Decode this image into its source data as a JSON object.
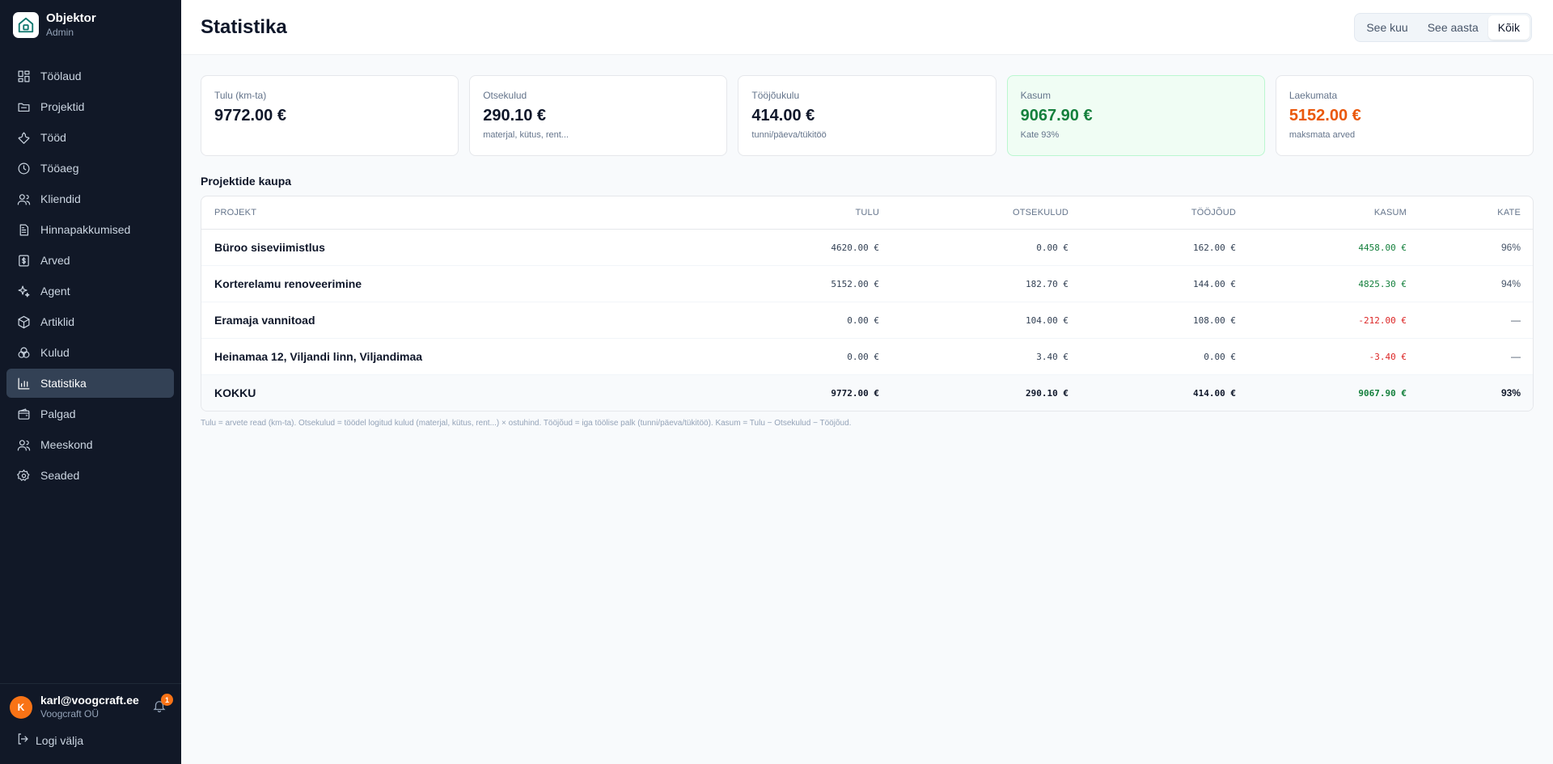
{
  "app": {
    "name": "Objektor",
    "role": "Admin"
  },
  "nav": {
    "items": [
      {
        "label": "Töölaud",
        "icon": "dashboard-icon"
      },
      {
        "label": "Projektid",
        "icon": "folder-icon"
      },
      {
        "label": "Tööd",
        "icon": "wrench-icon"
      },
      {
        "label": "Tööaeg",
        "icon": "clock-icon"
      },
      {
        "label": "Kliendid",
        "icon": "users-icon"
      },
      {
        "label": "Hinnapakkumised",
        "icon": "document-icon"
      },
      {
        "label": "Arved",
        "icon": "invoice-icon"
      },
      {
        "label": "Agent",
        "icon": "sparkles-icon"
      },
      {
        "label": "Artiklid",
        "icon": "box-icon"
      },
      {
        "label": "Kulud",
        "icon": "coins-icon"
      },
      {
        "label": "Statistika",
        "icon": "bar-chart-icon"
      },
      {
        "label": "Palgad",
        "icon": "wallet-icon"
      },
      {
        "label": "Meeskond",
        "icon": "team-icon"
      },
      {
        "label": "Seaded",
        "icon": "gear-icon"
      }
    ],
    "active": "Statistika"
  },
  "user": {
    "initial": "K",
    "email": "karl@voogcraft.ee",
    "company": "Voogcraft OÜ",
    "notifications": "1",
    "logout_label": "Logi välja"
  },
  "header": {
    "title": "Statistika",
    "periods": [
      "See kuu",
      "See aasta",
      "Kõik"
    ],
    "active_period": "Kõik"
  },
  "cards": [
    {
      "label": "Tulu (km-ta)",
      "value": "9772.00 €",
      "sub": ""
    },
    {
      "label": "Otsekulud",
      "value": "290.10 €",
      "sub": "materjal, kütus, rent..."
    },
    {
      "label": "Tööjõukulu",
      "value": "414.00 €",
      "sub": "tunni/päeva/tükitöö"
    },
    {
      "label": "Kasum",
      "value": "9067.90 €",
      "sub": "Kate 93%"
    },
    {
      "label": "Laekumata",
      "value": "5152.00 €",
      "sub": "maksmata arved"
    }
  ],
  "section": {
    "title": "Projektide kaupa"
  },
  "table": {
    "columns": [
      "PROJEKT",
      "TULU",
      "OTSEKULUD",
      "TÖÖJÕUD",
      "KASUM",
      "KATE"
    ],
    "rows": [
      {
        "project": "Büroo siseviimistlus",
        "tulu": "4620.00 €",
        "otsekulud": "0.00 €",
        "toojoud": "162.00 €",
        "kasum": "4458.00 €",
        "kate": "96%"
      },
      {
        "project": "Korterelamu renoveerimine",
        "tulu": "5152.00 €",
        "otsekulud": "182.70 €",
        "toojoud": "144.00 €",
        "kasum": "4825.30 €",
        "kate": "94%"
      },
      {
        "project": "Eramaja vannitoad",
        "tulu": "0.00 €",
        "otsekulud": "104.00 €",
        "toojoud": "108.00 €",
        "kasum": "-212.00 €",
        "kate": "—"
      },
      {
        "project": "Heinamaa 12, Viljandi linn, Viljandimaa",
        "tulu": "0.00 €",
        "otsekulud": "3.40 €",
        "toojoud": "0.00 €",
        "kasum": "-3.40 €",
        "kate": "—"
      }
    ],
    "total": {
      "project": "KOKKU",
      "tulu": "9772.00 €",
      "otsekulud": "290.10 €",
      "toojoud": "414.00 €",
      "kasum": "9067.90 €",
      "kate": "93%"
    }
  },
  "footnote": "Tulu = arvete read (km-ta). Otsekulud = töödel logitud kulud (materjal, kütus, rent...) × ostuhind. Tööjõud = iga töölise palk (tunni/päeva/tükitöö). Kasum = Tulu − Otsekulud − Tööjõud.",
  "colors": {
    "sidebar_bg": "#111827",
    "profit": "#15803d",
    "unpaid": "#ea580c",
    "loss": "#dc2626",
    "accent_orange": "#f97316"
  }
}
